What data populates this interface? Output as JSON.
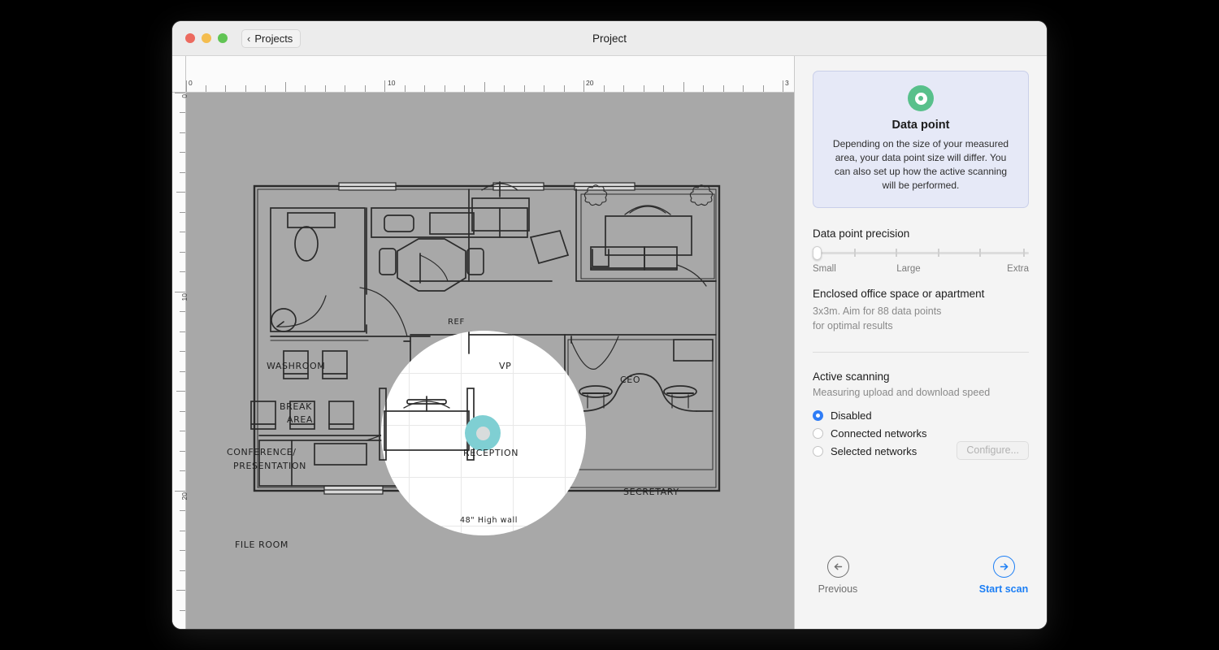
{
  "window": {
    "title": "Project",
    "back_label": "Projects",
    "traffic_lights": [
      "close-button",
      "minimize-button",
      "zoom-button"
    ]
  },
  "canvas": {
    "ruler_h_labels": [
      "0",
      "10",
      "20",
      "3"
    ],
    "ruler_v_labels": [
      "0",
      "10",
      "20"
    ],
    "datapoint_color": "#7fcfd3",
    "plan_background": "#a8a8a8",
    "floorplan_labels": [
      "WASHROOM",
      "BREAK",
      "AREA",
      "REF",
      "CEO",
      "CONFERENCE/",
      "PRESENTATION",
      "FILE ROOM",
      "VP",
      "RECEPTION",
      "SECRETARY",
      "48\" High wall"
    ]
  },
  "sidebar": {
    "info_card": {
      "icon": "data-point-icon",
      "accent": "#58c08b",
      "title": "Data point",
      "body": "Depending on the size of your measured area, your data point size will differ. You can also set up how the active scanning will be performed."
    },
    "precision": {
      "title": "Data point precision",
      "value": "Small",
      "ticks": 6,
      "labels": [
        "Small",
        "Large",
        "Extra"
      ]
    },
    "hint": {
      "title": "Enclosed office space or apartment",
      "body_line1": "3x3m. Aim for 88 data points",
      "body_line2": "for optimal results"
    },
    "active_scanning": {
      "title": "Active scanning",
      "subtitle": "Measuring upload and download speed",
      "selected": "Disabled",
      "options": [
        {
          "label": "Disabled",
          "selected": true
        },
        {
          "label": "Connected networks",
          "selected": false
        },
        {
          "label": "Selected networks",
          "selected": false
        }
      ],
      "configure_label": "Configure...",
      "configure_disabled": true,
      "accent": "#2f7df6"
    },
    "footer": {
      "previous_label": "Previous",
      "previous_icon": "arrow-left-circle-icon",
      "start_label": "Start scan",
      "start_icon": "arrow-right-circle-icon",
      "start_accent": "#1b7ef5"
    }
  }
}
